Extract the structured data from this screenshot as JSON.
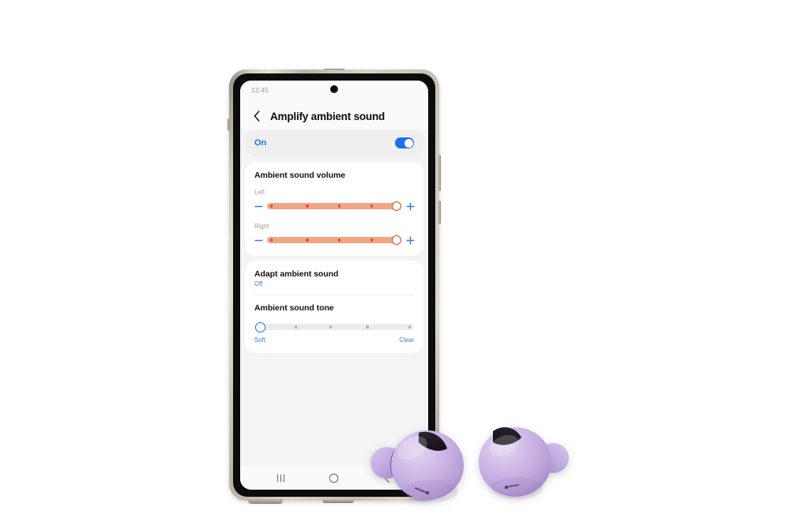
{
  "device": {
    "name": "Galaxy smartphone",
    "frame_color": "#cfc9bf",
    "bezel_color": "#0c0c0c"
  },
  "status_bar": {
    "time": "12:45",
    "camera_icon": "front-camera-punch-hole"
  },
  "header": {
    "back_icon": "chevron-left-icon",
    "title": "Amplify ambient sound"
  },
  "master_toggle": {
    "label": "On",
    "state": "on",
    "accent_color": "#1d6ef0"
  },
  "volume_section": {
    "title": "Ambient sound volume",
    "track_color": "#f0a584",
    "tick_color": "#e8502a",
    "thumb_border_color": "#dd4a17",
    "stepper_color": "#3d7ae0",
    "channels": [
      {
        "label": "Left",
        "minus_icon": "minus-icon",
        "plus_icon": "plus-icon",
        "value": 5,
        "min": 1,
        "max": 5,
        "ticks": 4
      },
      {
        "label": "Right",
        "minus_icon": "minus-icon",
        "plus_icon": "plus-icon",
        "value": 5,
        "min": 1,
        "max": 5,
        "ticks": 4
      }
    ]
  },
  "adapt_section": {
    "title": "Adapt ambient sound",
    "value": "Off"
  },
  "tone_section": {
    "title": "Ambient sound tone",
    "value": 1,
    "min": 1,
    "max": 5,
    "ticks": 4,
    "left_label": "Soft",
    "right_label": "Clear",
    "track_color": "#ebebeb",
    "tick_color": "#b2b2b2",
    "thumb_border_color": "#1a73e8",
    "label_color": "#3d7ae0"
  },
  "nav_bar": {
    "recents_icon": "recents-icon",
    "home_icon": "home-icon",
    "back_icon": "back-icon"
  },
  "earbuds": {
    "product": "wireless earbuds",
    "color": "#cbb4e2",
    "left_icon": "earbud-left-icon",
    "right_icon": "earbud-right-icon"
  }
}
